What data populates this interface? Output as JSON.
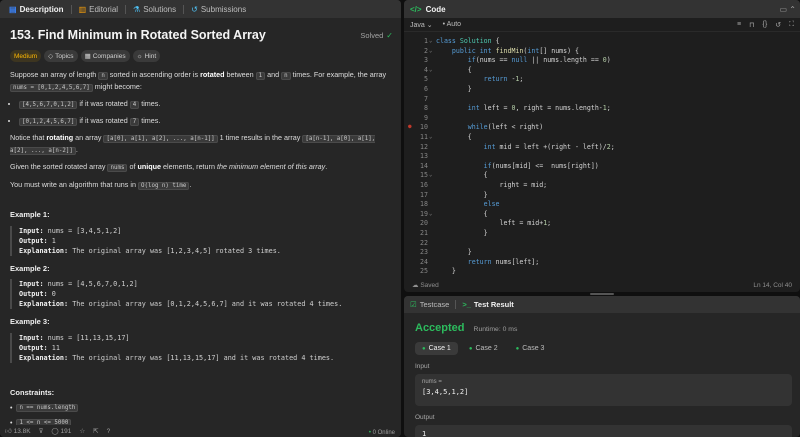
{
  "left_tabs": [
    {
      "label": "Description",
      "icon": "description-icon"
    },
    {
      "label": "Editorial",
      "icon": "book-icon"
    },
    {
      "label": "Solutions",
      "icon": "flask-icon"
    },
    {
      "label": "Submissions",
      "icon": "history-icon"
    }
  ],
  "problem": {
    "title": "153. Find Minimum in Rotated Sorted Array",
    "status": "Solved",
    "difficulty": "Medium",
    "tags": [
      "Topics",
      "Companies",
      "Hint"
    ]
  },
  "description": {
    "p1_a": "Suppose an array of length ",
    "p1_n": "n",
    "p1_b": " sorted in ascending order is ",
    "p1_rotated": "rotated",
    "p1_c": " between ",
    "p1_one": "1",
    "p1_d": " and ",
    "p1_n2": "n",
    "p1_e": " times. For example, the array ",
    "p1_arr": "nums = [0,1,2,4,5,6,7]",
    "p1_f": " might become:",
    "bullet1_code": "[4,5,6,7,0,1,2]",
    "bullet1_text": " if it was rotated ",
    "bullet1_num": "4",
    "bullet1_end": " times.",
    "bullet2_code": "[0,1,2,4,5,6,7]",
    "bullet2_text": " if it was rotated ",
    "bullet2_num": "7",
    "bullet2_end": " times.",
    "p2_a": "Notice that ",
    "p2_b": "rotating",
    "p2_c": " an array ",
    "p2_code1": "[a[0], a[1], a[2], ..., a[n-1]]",
    "p2_d": " 1 time results in the array ",
    "p2_code2": "[a[n-1], a[0], a[1], a[2], ..., a[n-2]]",
    "p2_e": ".",
    "p3_a": "Given the sorted rotated array ",
    "p3_code": "nums",
    "p3_b": " of ",
    "p3_unique": "unique",
    "p3_c": " elements, return ",
    "p3_italic": "the minimum element of this array",
    "p3_d": ".",
    "p4_a": "You must write an algorithm that runs in ",
    "p4_code": "O(log n) time",
    "p4_b": "."
  },
  "examples": [
    {
      "title": "Example 1:",
      "input": "nums = [3,4,5,1,2]",
      "output": "1",
      "explanation": "The original array was [1,2,3,4,5] rotated 3 times."
    },
    {
      "title": "Example 2:",
      "input": "nums = [4,5,6,7,0,1,2]",
      "output": "0",
      "explanation": "The original array was [0,1,2,4,5,6,7] and it was rotated 4 times."
    },
    {
      "title": "Example 3:",
      "input": "nums = [11,13,15,17]",
      "output": "11",
      "explanation": "The original array was [11,13,15,17] and it was rotated 4 times."
    }
  ],
  "labels": {
    "input": "Input:",
    "output": "Output:",
    "explanation": "Explanation:"
  },
  "constraints": {
    "title": "Constraints:",
    "c1": "n == nums.length",
    "c2": "1 <= n <= 5000"
  },
  "left_footer": {
    "likes": "13.8K",
    "comments": "191",
    "online": "0 Online"
  },
  "code_panel": {
    "title": "Code",
    "language": "Java",
    "mode": "Auto",
    "saved": "Saved",
    "cursor": "Ln 14, Col 40"
  },
  "code_lines": [
    {
      "n": "1",
      "fold": true,
      "text": "class Solution {"
    },
    {
      "n": "2",
      "fold": true,
      "text": "    public int findMin(int[] nums) {"
    },
    {
      "n": "3",
      "fold": false,
      "text": "        if(nums == null || nums.length == 0)"
    },
    {
      "n": "4",
      "fold": true,
      "text": "        {"
    },
    {
      "n": "5",
      "fold": false,
      "text": "            return -1;"
    },
    {
      "n": "6",
      "fold": false,
      "text": "        }"
    },
    {
      "n": "7",
      "fold": false,
      "text": ""
    },
    {
      "n": "8",
      "fold": false,
      "text": "        int left = 0, right = nums.length-1;"
    },
    {
      "n": "9",
      "fold": false,
      "text": ""
    },
    {
      "n": "10",
      "fold": false,
      "text": "        while(left < right)"
    },
    {
      "n": "11",
      "fold": true,
      "text": "        {"
    },
    {
      "n": "12",
      "fold": false,
      "text": "            int mid = left +(right - left)/2;"
    },
    {
      "n": "13",
      "fold": false,
      "text": ""
    },
    {
      "n": "14",
      "fold": false,
      "text": "            if(nums[mid] <=  nums[right])"
    },
    {
      "n": "15",
      "fold": true,
      "text": "            {"
    },
    {
      "n": "16",
      "fold": false,
      "text": "                right = mid;"
    },
    {
      "n": "17",
      "fold": false,
      "text": "            }"
    },
    {
      "n": "18",
      "fold": false,
      "text": "            else"
    },
    {
      "n": "19",
      "fold": true,
      "text": "            {"
    },
    {
      "n": "20",
      "fold": false,
      "text": "                left = mid+1;"
    },
    {
      "n": "21",
      "fold": false,
      "text": "            }"
    },
    {
      "n": "22",
      "fold": false,
      "text": ""
    },
    {
      "n": "23",
      "fold": false,
      "text": "        }"
    },
    {
      "n": "24",
      "fold": false,
      "text": "        return nums[left];"
    },
    {
      "n": "25",
      "fold": false,
      "text": "    }"
    }
  ],
  "test_panel": {
    "tab_testcase": "Testcase",
    "tab_result": "Test Result",
    "status": "Accepted",
    "runtime": "Runtime: 0 ms",
    "cases": [
      "Case 1",
      "Case 2",
      "Case 3"
    ],
    "input_label": "Input",
    "input_var": "nums =",
    "input_value": "[3,4,5,1,2]",
    "output_label": "Output",
    "output_value": "1"
  },
  "colors": {
    "accent_green": "#2cbb5d",
    "medium": "#ffb800",
    "bg": "#0f0f0f",
    "panel": "#262626"
  }
}
